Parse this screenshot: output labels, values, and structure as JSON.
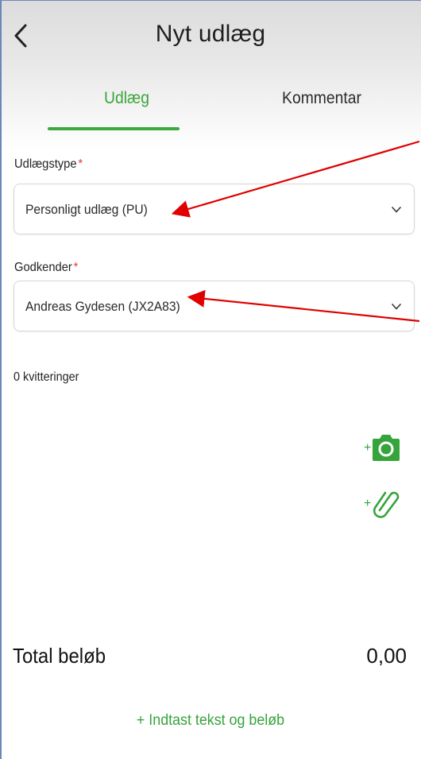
{
  "header": {
    "title": "Nyt udlæg",
    "back_icon": "chevron-left-icon"
  },
  "tabs": [
    {
      "label": "Udlæg",
      "active": true
    },
    {
      "label": "Kommentar",
      "active": false
    }
  ],
  "form": {
    "type_label": "Udlægstype",
    "type_required": "*",
    "type_value": "Personligt udlæg (PU)",
    "approver_label": "Godkender",
    "approver_required": "*",
    "approver_value": "Andreas Gydesen (JX2A83)"
  },
  "receipts": {
    "count_text": "0 kvitteringer",
    "add_photo_icon": "add-camera-icon",
    "add_attachment_icon": "add-paperclip-icon"
  },
  "total": {
    "label": "Total beløb",
    "value": "0,00"
  },
  "footer": {
    "enter_link": "+ Indtast tekst og beløb"
  },
  "colors": {
    "accent_green": "#3ca842",
    "annotation_arrow": "#e00000",
    "required_star": "#e53b3b"
  }
}
